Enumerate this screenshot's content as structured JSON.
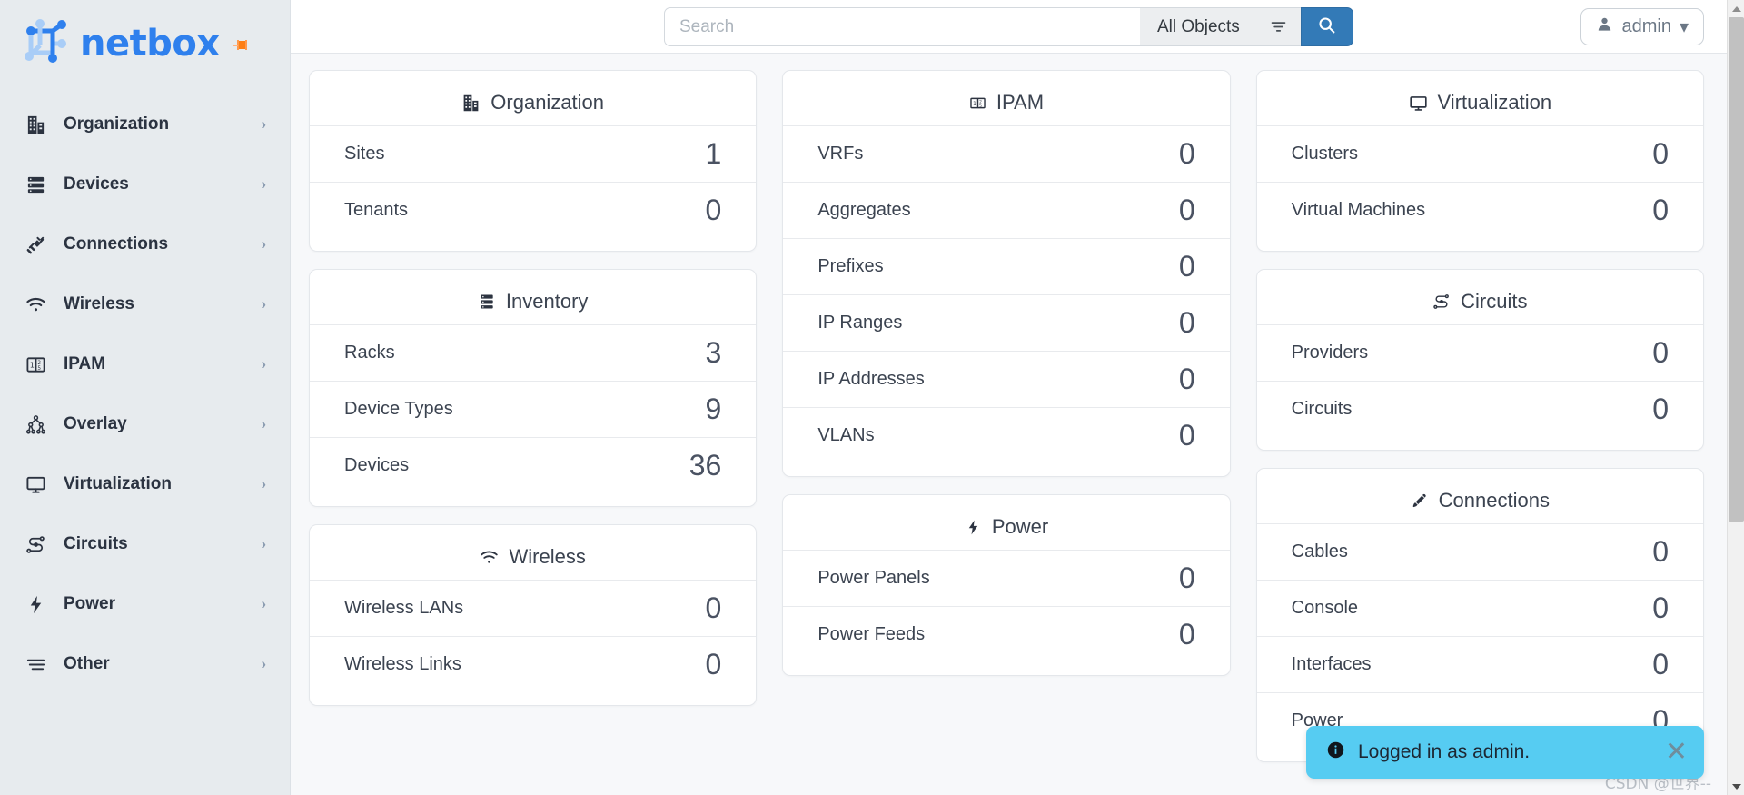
{
  "brand": {
    "name": "netbox",
    "pin_icon": "pin-icon",
    "logo_icon": "netbox-logo-icon"
  },
  "sidebar": {
    "items": [
      {
        "label": "Organization",
        "icon": "building-icon",
        "chevron": "›"
      },
      {
        "label": "Devices",
        "icon": "server-rack-icon",
        "chevron": "›"
      },
      {
        "label": "Connections",
        "icon": "plug-connect-icon",
        "chevron": "›"
      },
      {
        "label": "Wireless",
        "icon": "wifi-icon",
        "chevron": "›"
      },
      {
        "label": "IPAM",
        "icon": "counter-icon",
        "chevron": "›"
      },
      {
        "label": "Overlay",
        "icon": "network-tree-icon",
        "chevron": "›"
      },
      {
        "label": "Virtualization",
        "icon": "monitor-icon",
        "chevron": "›"
      },
      {
        "label": "Circuits",
        "icon": "circuit-icon",
        "chevron": "›"
      },
      {
        "label": "Power",
        "icon": "lightning-bolt-icon",
        "chevron": "›"
      },
      {
        "label": "Other",
        "icon": "menu-lines-icon",
        "chevron": "›"
      }
    ]
  },
  "topbar": {
    "search_value": "",
    "search_placeholder": "Search",
    "object_scope": "All Objects",
    "filter_icon": "filter-icon",
    "search_icon": "search-icon",
    "user_icon": "user-avatar-icon",
    "user_label": "admin",
    "user_caret": "▾",
    "accent_color": "#337ab7"
  },
  "cards": {
    "organization": {
      "title": "Organization",
      "icon": "building-icon",
      "rows": [
        {
          "label": "Sites",
          "value": "1"
        },
        {
          "label": "Tenants",
          "value": "0"
        }
      ]
    },
    "inventory": {
      "title": "Inventory",
      "icon": "server-rack-icon",
      "rows": [
        {
          "label": "Racks",
          "value": "3"
        },
        {
          "label": "Device Types",
          "value": "9"
        },
        {
          "label": "Devices",
          "value": "36"
        }
      ]
    },
    "wireless": {
      "title": "Wireless",
      "icon": "wifi-icon",
      "rows": [
        {
          "label": "Wireless LANs",
          "value": "0"
        },
        {
          "label": "Wireless Links",
          "value": "0"
        }
      ]
    },
    "ipam": {
      "title": "IPAM",
      "icon": "counter-icon",
      "rows": [
        {
          "label": "VRFs",
          "value": "0"
        },
        {
          "label": "Aggregates",
          "value": "0"
        },
        {
          "label": "Prefixes",
          "value": "0"
        },
        {
          "label": "IP Ranges",
          "value": "0"
        },
        {
          "label": "IP Addresses",
          "value": "0"
        },
        {
          "label": "VLANs",
          "value": "0"
        }
      ]
    },
    "power": {
      "title": "Power",
      "icon": "lightning-bolt-icon",
      "rows": [
        {
          "label": "Power Panels",
          "value": "0"
        },
        {
          "label": "Power Feeds",
          "value": "0"
        }
      ]
    },
    "virtualization": {
      "title": "Virtualization",
      "icon": "monitor-icon",
      "rows": [
        {
          "label": "Clusters",
          "value": "0"
        },
        {
          "label": "Virtual Machines",
          "value": "0"
        }
      ]
    },
    "circuits": {
      "title": "Circuits",
      "icon": "circuit-icon",
      "rows": [
        {
          "label": "Providers",
          "value": "0"
        },
        {
          "label": "Circuits",
          "value": "0"
        }
      ]
    },
    "connections": {
      "title": "Connections",
      "icon": "cable-icon",
      "rows": [
        {
          "label": "Cables",
          "value": "0"
        },
        {
          "label": "Console",
          "value": "0"
        },
        {
          "label": "Interfaces",
          "value": "0"
        },
        {
          "label": "Power",
          "value": "0"
        }
      ]
    }
  },
  "toast": {
    "message": "Logged in as admin.",
    "info_icon": "info-circle-icon",
    "close_icon": "close-icon",
    "close_label": "✕",
    "background_color": "#56ccf2"
  },
  "watermark": {
    "text": "CSDN @世界--"
  }
}
